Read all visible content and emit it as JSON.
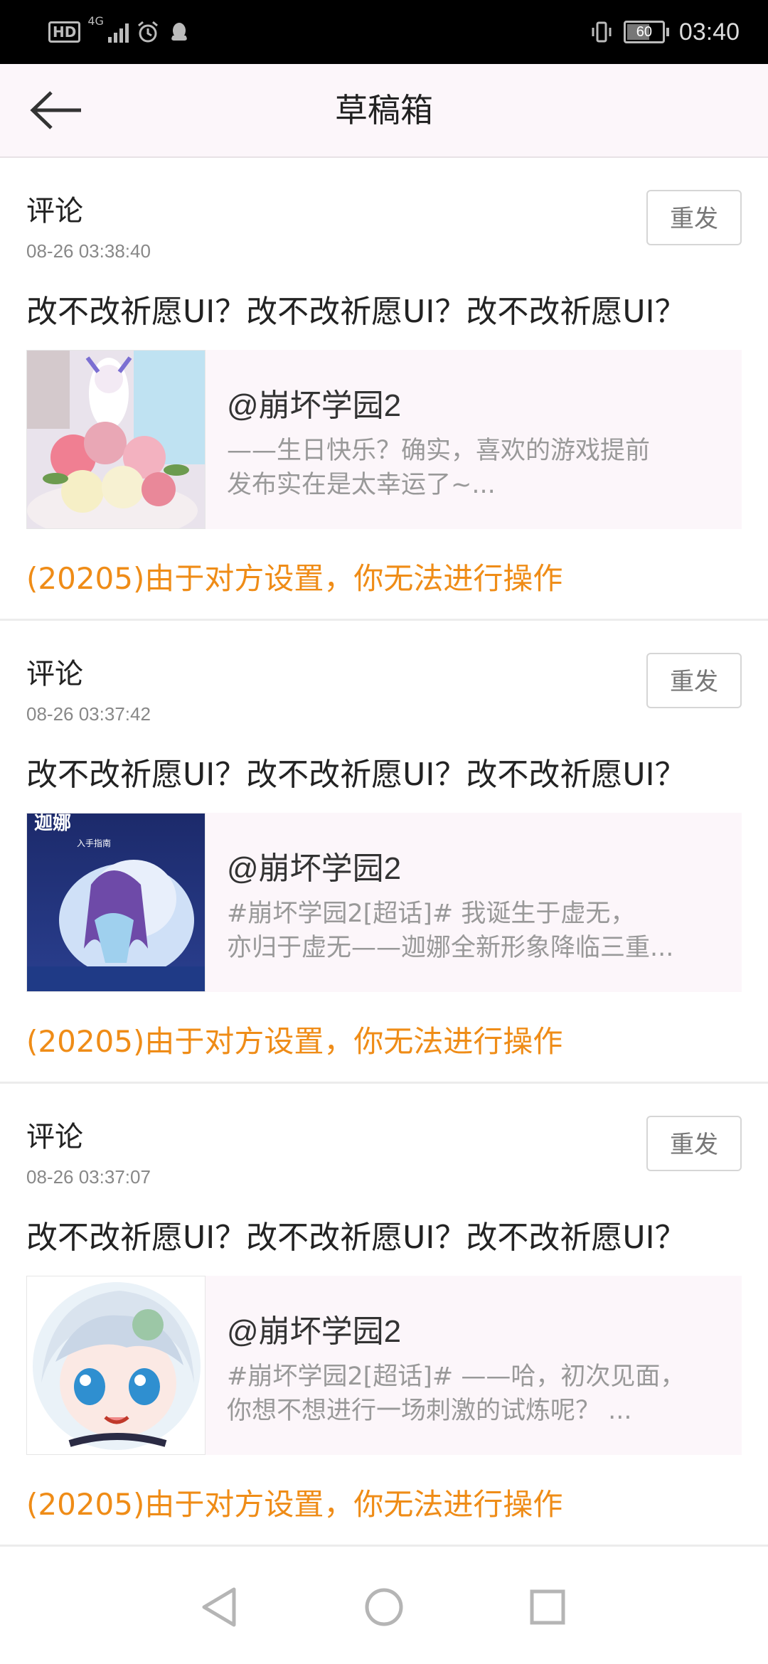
{
  "status_bar": {
    "time": "03:40",
    "battery": "60",
    "network": "4G",
    "hd": "HD",
    "left_icons": [
      "hd-icon",
      "signal-icon",
      "alarm-icon",
      "qq-icon"
    ],
    "right_icons": [
      "vibrate-icon",
      "battery-icon"
    ]
  },
  "header": {
    "title": "草稿箱",
    "back_icon": "arrow-left-icon"
  },
  "drafts": [
    {
      "type": "评论",
      "time": "08-26 03:38:40",
      "resend_label": "重发",
      "text": "改不改祈愿UI？改不改祈愿UI？改不改祈愿UI？",
      "quote_author": "@崩坏学园2",
      "quote_line1": "——生日快乐？确实，喜欢的游戏提前",
      "quote_line2": "发布实在是太幸运了~...",
      "error": "(20205)由于对方设置，你无法进行操作"
    },
    {
      "type": "评论",
      "time": "08-26 03:37:42",
      "resend_label": "重发",
      "text": "改不改祈愿UI？改不改祈愿UI？改不改祈愿UI？",
      "quote_author": "@崩坏学园2",
      "quote_line1": "#崩坏学园2[超话]# 我诞生于虚无，",
      "quote_line2": "亦归于虚无——迦娜全新形象降临三重...",
      "thumb_caption": "迦娜",
      "thumb_subcaption": "入手指南",
      "error": "(20205)由于对方设置，你无法进行操作"
    },
    {
      "type": "评论",
      "time": "08-26 03:37:07",
      "resend_label": "重发",
      "text": "改不改祈愿UI？改不改祈愿UI？改不改祈愿UI？",
      "quote_author": "@崩坏学园2",
      "quote_line1": "#崩坏学园2[超话]#  ——哈，初次见面，",
      "quote_line2": "你想不想进行一场刺激的试炼呢？ ...",
      "error": "(20205)由于对方设置，你无法进行操作"
    }
  ],
  "nav_bar": {
    "icons": [
      "back-triangle-icon",
      "home-circle-icon",
      "recents-square-icon"
    ]
  },
  "colors": {
    "error": "#ef8c17",
    "header_bg": "#fcf6fa",
    "quote_bg": "#fcf6fa"
  }
}
